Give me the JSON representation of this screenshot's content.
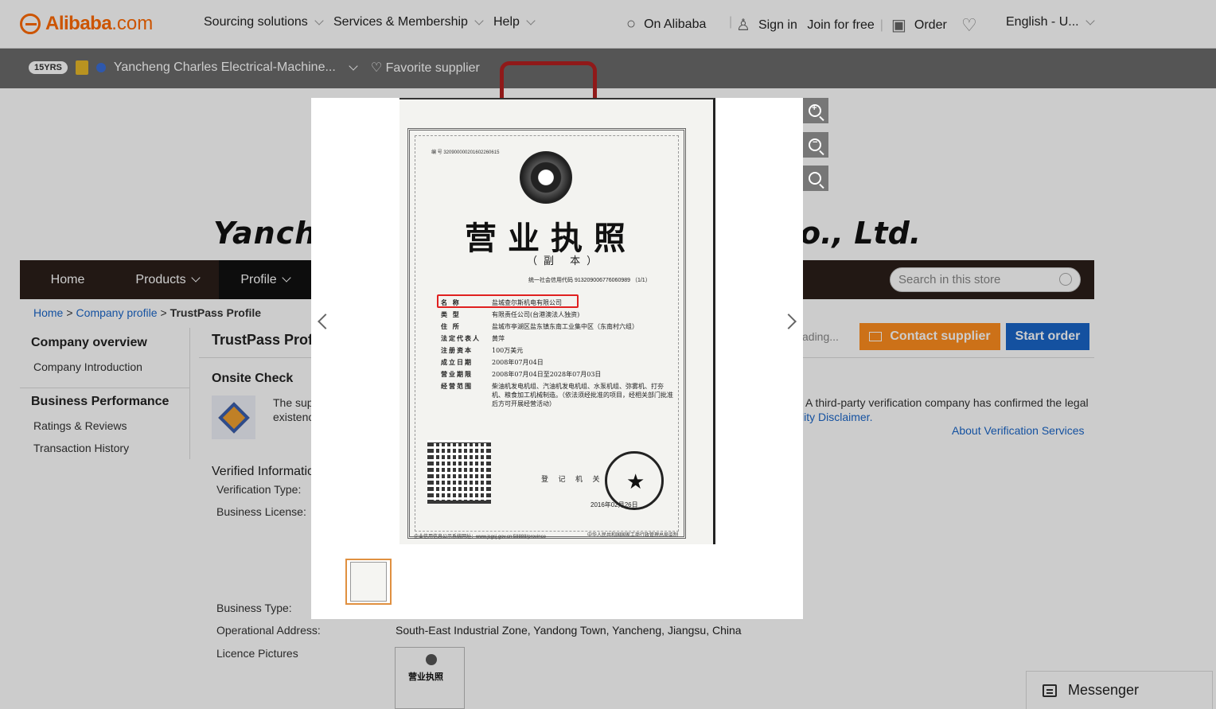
{
  "header": {
    "logo_text": "Alibaba",
    "logo_suffix": ".com",
    "nav": [
      "Sourcing solutions",
      "Services & Membership",
      "Help"
    ],
    "on_alibaba": "On Alibaba",
    "sign_in": "Sign in",
    "join": "Join for free",
    "order": "Order",
    "language": "English - U..."
  },
  "store_bar": {
    "years": "15YRS",
    "company": "Yancheng Charles Electrical-Machine...",
    "favorite": "Favorite supplier"
  },
  "banner": {
    "title_left": "Yanche",
    "title_right": "o., Ltd."
  },
  "store_nav": {
    "items": [
      "Home",
      "Products",
      "Profile"
    ],
    "search_placeholder": "Search in this store"
  },
  "breadcrumb": {
    "home": "Home",
    "sep1": ">",
    "company_profile": "Company profile",
    "sep2": ">",
    "current": "TrustPass Profile"
  },
  "sidebar": {
    "section1": "Company overview",
    "section1_items": [
      "Company Introduction"
    ],
    "section2": "Business Performance",
    "section2_items": [
      "Ratings & Reviews",
      "Transaction History"
    ]
  },
  "main": {
    "title": "TrustPass Prof",
    "loading": "ading...",
    "contact_button": "Contact supplier",
    "start_button": "Start order",
    "onsite_title": "Onsite Check",
    "onsite_text1": "The sup",
    "onsite_text2": "existenc",
    "onsite_right1": "A third-party verification company has confirmed the legal",
    "onsite_right2": "lity Disclaimer.",
    "about_verification": "About Verification Services",
    "verified_title": "Verified Informatio",
    "rows": [
      {
        "label": "Verification Type:",
        "value": ""
      },
      {
        "label": "Business License:",
        "value": ""
      },
      {
        "label": "Business Type:",
        "value": ""
      },
      {
        "label": "Operational Address:",
        "value": "South-East Industrial Zone, Yandong Town, Yancheng, Jiangsu, China"
      },
      {
        "label": "Licence Pictures",
        "value": ""
      }
    ],
    "thumb_title": "营业执照"
  },
  "viewer": {
    "doc_number": "编 号 320900000201602260615",
    "doc_title": "营业执照",
    "doc_subtitle": "（副 本）",
    "credit_code": "统一社会信用代码 913209006776060989 （1/1）",
    "fields": [
      {
        "key": "名 称",
        "value": "盐城查尔斯机电有限公司"
      },
      {
        "key": "类 型",
        "value": "有限责任公司(台港澳法人独资)"
      },
      {
        "key": "住 所",
        "value": "盐城市亭湖区盐东镇东南工业集中区（东南村六组）"
      },
      {
        "key": "法定代表人",
        "value": "黄萍"
      },
      {
        "key": "注册资本",
        "value": "100万美元"
      },
      {
        "key": "成立日期",
        "value": "2008年07月04日"
      },
      {
        "key": "营业期限",
        "value": "2008年07月04日至2028年07月03日"
      },
      {
        "key": "经营范围",
        "value": "柴油机发电机组、汽油机发电机组、水泵机组、弥雾机、打夯机、粮食加工机械制造。（依法须经批准的项目，经相关部门批准后方可开展经营活动）"
      }
    ],
    "registration_office": "登 记 机 关",
    "date": "2016年02月26日",
    "footer_left": "企业信用信息公示系统网址：www.jsgsj.gov.cn:58888/province",
    "footer_right": "中华人民共和国国家工商行政管理总局监制"
  },
  "messenger": {
    "label": "Messenger"
  }
}
